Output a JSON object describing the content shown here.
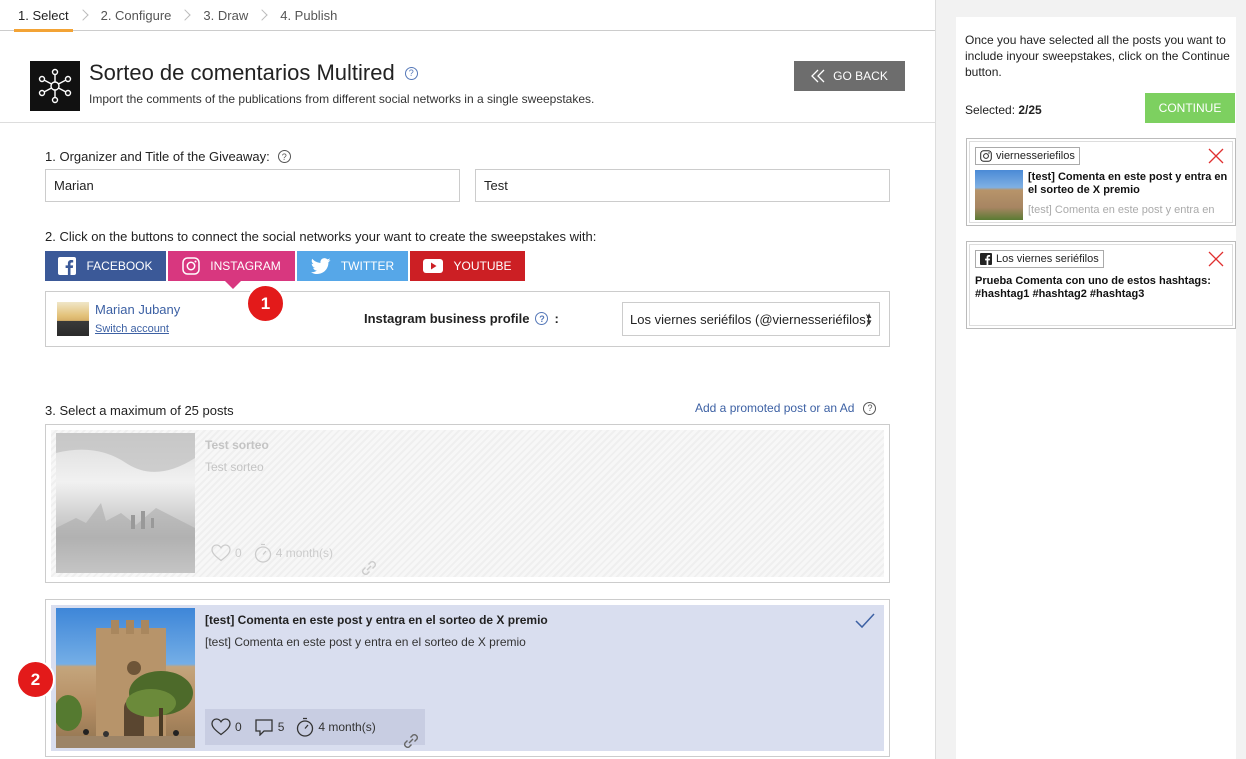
{
  "steps": [
    {
      "label": "1. Select",
      "active": true
    },
    {
      "label": "2. Configure"
    },
    {
      "label": "3. Draw"
    },
    {
      "label": "4. Publish"
    }
  ],
  "header": {
    "title": "Sorteo de comentarios Multired",
    "subtitle": "Import the comments of the publications from different social networks in a single sweepstakes.",
    "go_back_label": "GO BACK",
    "help_glyph": "?"
  },
  "form": {
    "step1_label": "1.  Organizer and Title of the Giveaway:",
    "organizer_value": "Marian",
    "title_value": "Test",
    "step2_label": "2. Click on the buttons to connect the social networks your want to create the sweepstakes with:",
    "networks": [
      {
        "label": "FACEBOOK",
        "color": "#3b5998"
      },
      {
        "label": "INSTAGRAM",
        "color": "#d8377f"
      },
      {
        "label": "TWITTER",
        "color": "#56a7e8"
      },
      {
        "label": "YOUTUBE",
        "color": "#cc1f24"
      }
    ]
  },
  "account": {
    "name": "Marian Jubany",
    "switch_label": "Switch account",
    "profile_label": "Instagram business profile",
    "profile_value": "Los viernes seriéfilos (@viernesseriéfilos)",
    "profile_separator": ":"
  },
  "badges": [
    "1",
    "2"
  ],
  "posts_section": {
    "label": "3. Select a maximum of 25 posts",
    "promo_link": "Add a promoted post or an Ad"
  },
  "posts": [
    {
      "title": "Test sorteo",
      "body": "Test sorteo",
      "likes": "0",
      "age": "4 month(s)",
      "state": "disabled"
    },
    {
      "title": "[test] Comenta en este post y entra en el sorteo de X premio",
      "body": "[test] Comenta en este post y entra en el sorteo de X premio",
      "likes": "0",
      "comments": "5",
      "age": "4 month(s)",
      "state": "selected"
    }
  ],
  "sidebar": {
    "help_text": "Once you have selected all the posts you want to include inyour sweepstakes, click on the Continue button.",
    "selected_label": "Selected: ",
    "selected_value": "2/25",
    "continue_label": "CONTINUE",
    "cards": [
      {
        "account": "viernesseriefilos",
        "network": "instagram",
        "title": "[test] Comenta en este post y entra en el sorteo de X premio",
        "body": "[test] Comenta en este post y entra en"
      },
      {
        "account": "Los viernes seriéfilos",
        "network": "facebook",
        "title": "Prueba Comenta con uno de estos hashtags: #hashtag1 #hashtag2 #hashtag3"
      }
    ]
  },
  "colors": {
    "accent": "#f3a335",
    "link": "#3d61a4",
    "continue": "#7dd060",
    "badge": "#e31a1a",
    "selected_bg": "#d9deef"
  }
}
